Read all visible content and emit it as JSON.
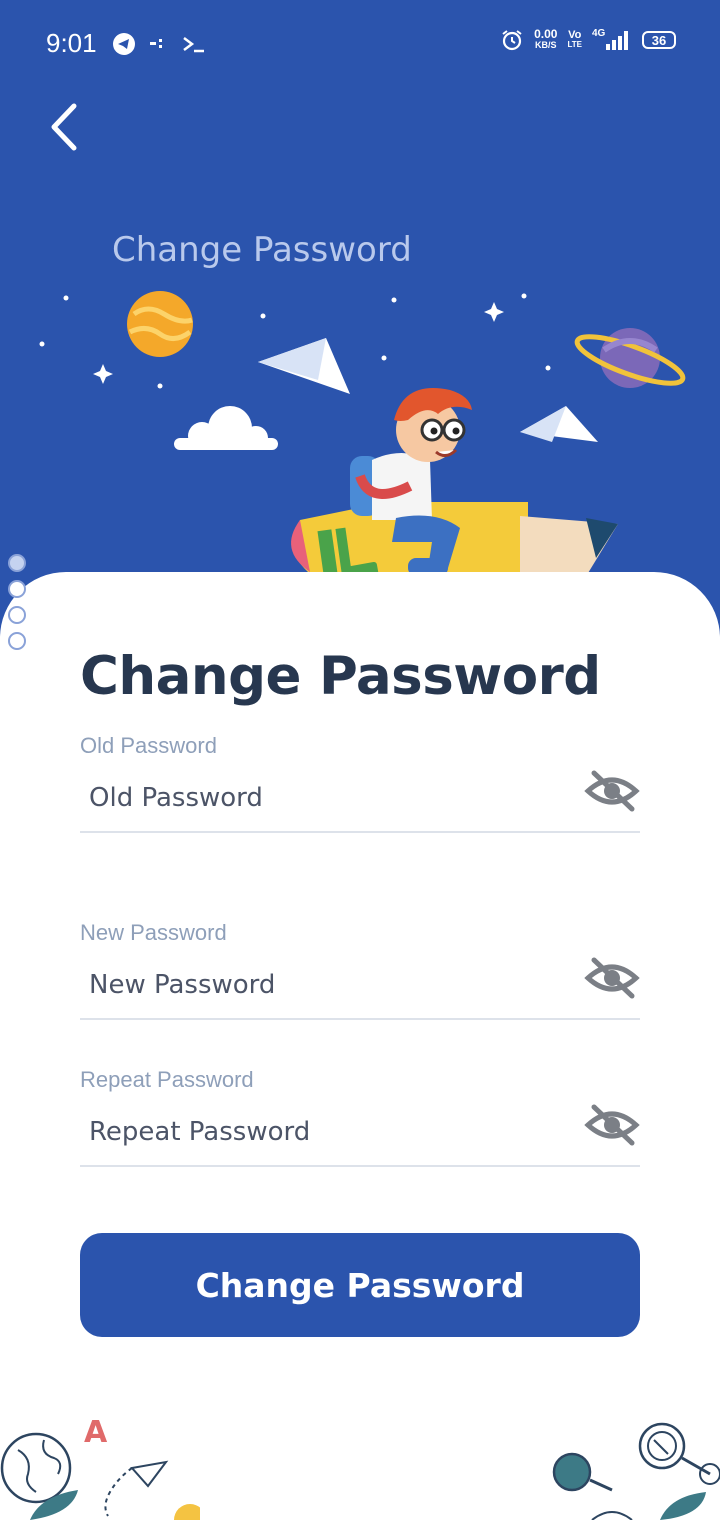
{
  "status_bar": {
    "time": "9:01",
    "net_speed_value": "0.00",
    "net_speed_unit": "KB/S",
    "volte_top": "Vo",
    "volte_bottom": "LTE",
    "network": "4G",
    "battery": "36"
  },
  "header": {
    "title": "Change Password"
  },
  "form": {
    "title": "Change Password",
    "old_password": {
      "label": "Old Password",
      "placeholder": "Old Password"
    },
    "new_password": {
      "label": "New Password",
      "placeholder": "New Password"
    },
    "repeat_password": {
      "label": "Repeat Password",
      "placeholder": "Repeat Password"
    },
    "submit_label": "Change Password"
  },
  "doodle": {
    "letter": "A"
  },
  "colors": {
    "primary": "#2b54ad",
    "title_text": "#27374f",
    "label_text": "#8e9fb9",
    "divider": "#dde2ea"
  }
}
